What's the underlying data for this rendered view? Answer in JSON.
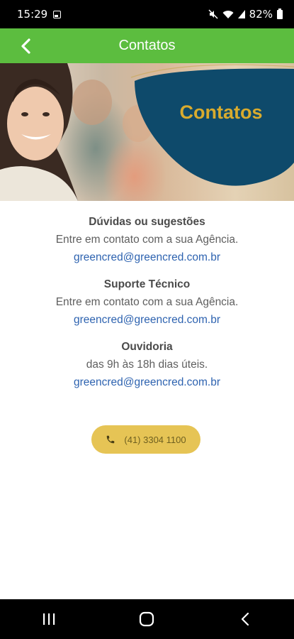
{
  "status_bar": {
    "time": "15:29",
    "battery": "82%",
    "icons": [
      "image-icon",
      "mute-icon",
      "wifi-icon",
      "signal-icon",
      "battery-icon"
    ]
  },
  "app_bar": {
    "title": "Contatos",
    "back_icon": "chevron-left-icon",
    "color": "#5cbd3f"
  },
  "banner": {
    "title": "Contatos",
    "shape_color": "#0e4a6b",
    "title_color": "#d8ab2e"
  },
  "sections": [
    {
      "title": "Dúvidas ou sugestões",
      "text": "Entre em contato com a sua Agência.",
      "email": "greencred@greencred.com.br"
    },
    {
      "title": "Suporte Técnico",
      "text": "Entre em contato com a sua Agência.",
      "email": "greencred@greencred.com.br"
    },
    {
      "title": "Ouvidoria",
      "text": "das 9h às 18h dias úteis.",
      "email": "greencred@greencred.com.br"
    }
  ],
  "phone": {
    "label": "(41) 3304 1100",
    "icon": "phone-icon",
    "color": "#e6c455"
  },
  "nav_bar": {
    "items": [
      "recent-apps-icon",
      "home-icon",
      "back-icon"
    ]
  }
}
